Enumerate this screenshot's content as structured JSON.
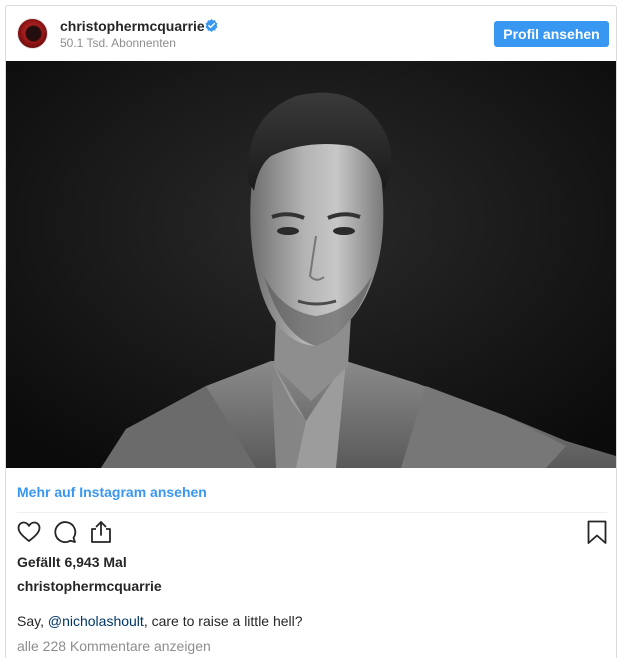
{
  "header": {
    "username": "christophermcquarrie",
    "followers": "50.1 Tsd. Abonnenten",
    "profile_button": "Profil ansehen",
    "verified_icon": "verified-badge-icon",
    "verified_color": "#3897f0"
  },
  "more_link": "Mehr auf Instagram ansehen",
  "actions": {
    "like_icon": "heart-icon",
    "comment_icon": "comment-bubble-icon",
    "share_icon": "share-icon",
    "save_icon": "bookmark-icon"
  },
  "likes": "Gefällt 6,943 Mal",
  "caption": {
    "username": "christophermcquarrie",
    "text_before": "Say, ",
    "mention": "@nicholashoult",
    "text_after": ", care to raise a little hell?"
  },
  "comments_link": "alle 228 Kommentare anzeigen",
  "colors": {
    "accent": "#3897f0",
    "mention": "#003569",
    "muted": "#8e8e8e"
  }
}
